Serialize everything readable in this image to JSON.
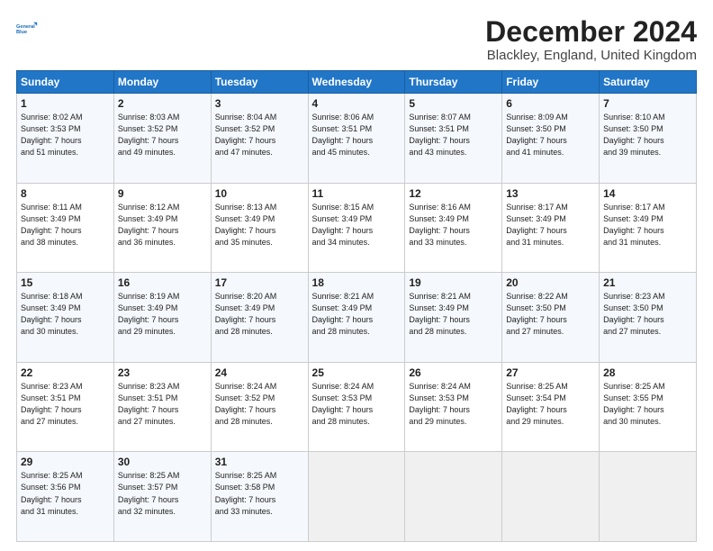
{
  "header": {
    "logo_line1": "General",
    "logo_line2": "Blue",
    "month_title": "December 2024",
    "location": "Blackley, England, United Kingdom"
  },
  "days_of_week": [
    "Sunday",
    "Monday",
    "Tuesday",
    "Wednesday",
    "Thursday",
    "Friday",
    "Saturday"
  ],
  "weeks": [
    [
      {
        "day": "1",
        "info": "Sunrise: 8:02 AM\nSunset: 3:53 PM\nDaylight: 7 hours\nand 51 minutes."
      },
      {
        "day": "2",
        "info": "Sunrise: 8:03 AM\nSunset: 3:52 PM\nDaylight: 7 hours\nand 49 minutes."
      },
      {
        "day": "3",
        "info": "Sunrise: 8:04 AM\nSunset: 3:52 PM\nDaylight: 7 hours\nand 47 minutes."
      },
      {
        "day": "4",
        "info": "Sunrise: 8:06 AM\nSunset: 3:51 PM\nDaylight: 7 hours\nand 45 minutes."
      },
      {
        "day": "5",
        "info": "Sunrise: 8:07 AM\nSunset: 3:51 PM\nDaylight: 7 hours\nand 43 minutes."
      },
      {
        "day": "6",
        "info": "Sunrise: 8:09 AM\nSunset: 3:50 PM\nDaylight: 7 hours\nand 41 minutes."
      },
      {
        "day": "7",
        "info": "Sunrise: 8:10 AM\nSunset: 3:50 PM\nDaylight: 7 hours\nand 39 minutes."
      }
    ],
    [
      {
        "day": "8",
        "info": "Sunrise: 8:11 AM\nSunset: 3:49 PM\nDaylight: 7 hours\nand 38 minutes."
      },
      {
        "day": "9",
        "info": "Sunrise: 8:12 AM\nSunset: 3:49 PM\nDaylight: 7 hours\nand 36 minutes."
      },
      {
        "day": "10",
        "info": "Sunrise: 8:13 AM\nSunset: 3:49 PM\nDaylight: 7 hours\nand 35 minutes."
      },
      {
        "day": "11",
        "info": "Sunrise: 8:15 AM\nSunset: 3:49 PM\nDaylight: 7 hours\nand 34 minutes."
      },
      {
        "day": "12",
        "info": "Sunrise: 8:16 AM\nSunset: 3:49 PM\nDaylight: 7 hours\nand 33 minutes."
      },
      {
        "day": "13",
        "info": "Sunrise: 8:17 AM\nSunset: 3:49 PM\nDaylight: 7 hours\nand 31 minutes."
      },
      {
        "day": "14",
        "info": "Sunrise: 8:17 AM\nSunset: 3:49 PM\nDaylight: 7 hours\nand 31 minutes."
      }
    ],
    [
      {
        "day": "15",
        "info": "Sunrise: 8:18 AM\nSunset: 3:49 PM\nDaylight: 7 hours\nand 30 minutes."
      },
      {
        "day": "16",
        "info": "Sunrise: 8:19 AM\nSunset: 3:49 PM\nDaylight: 7 hours\nand 29 minutes."
      },
      {
        "day": "17",
        "info": "Sunrise: 8:20 AM\nSunset: 3:49 PM\nDaylight: 7 hours\nand 28 minutes."
      },
      {
        "day": "18",
        "info": "Sunrise: 8:21 AM\nSunset: 3:49 PM\nDaylight: 7 hours\nand 28 minutes."
      },
      {
        "day": "19",
        "info": "Sunrise: 8:21 AM\nSunset: 3:49 PM\nDaylight: 7 hours\nand 28 minutes."
      },
      {
        "day": "20",
        "info": "Sunrise: 8:22 AM\nSunset: 3:50 PM\nDaylight: 7 hours\nand 27 minutes."
      },
      {
        "day": "21",
        "info": "Sunrise: 8:23 AM\nSunset: 3:50 PM\nDaylight: 7 hours\nand 27 minutes."
      }
    ],
    [
      {
        "day": "22",
        "info": "Sunrise: 8:23 AM\nSunset: 3:51 PM\nDaylight: 7 hours\nand 27 minutes."
      },
      {
        "day": "23",
        "info": "Sunrise: 8:23 AM\nSunset: 3:51 PM\nDaylight: 7 hours\nand 27 minutes."
      },
      {
        "day": "24",
        "info": "Sunrise: 8:24 AM\nSunset: 3:52 PM\nDaylight: 7 hours\nand 28 minutes."
      },
      {
        "day": "25",
        "info": "Sunrise: 8:24 AM\nSunset: 3:53 PM\nDaylight: 7 hours\nand 28 minutes."
      },
      {
        "day": "26",
        "info": "Sunrise: 8:24 AM\nSunset: 3:53 PM\nDaylight: 7 hours\nand 29 minutes."
      },
      {
        "day": "27",
        "info": "Sunrise: 8:25 AM\nSunset: 3:54 PM\nDaylight: 7 hours\nand 29 minutes."
      },
      {
        "day": "28",
        "info": "Sunrise: 8:25 AM\nSunset: 3:55 PM\nDaylight: 7 hours\nand 30 minutes."
      }
    ],
    [
      {
        "day": "29",
        "info": "Sunrise: 8:25 AM\nSunset: 3:56 PM\nDaylight: 7 hours\nand 31 minutes."
      },
      {
        "day": "30",
        "info": "Sunrise: 8:25 AM\nSunset: 3:57 PM\nDaylight: 7 hours\nand 32 minutes."
      },
      {
        "day": "31",
        "info": "Sunrise: 8:25 AM\nSunset: 3:58 PM\nDaylight: 7 hours\nand 33 minutes."
      },
      {
        "day": "",
        "info": ""
      },
      {
        "day": "",
        "info": ""
      },
      {
        "day": "",
        "info": ""
      },
      {
        "day": "",
        "info": ""
      }
    ]
  ]
}
